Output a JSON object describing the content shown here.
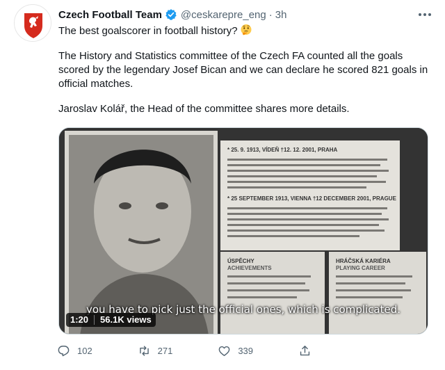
{
  "author": {
    "name": "Czech Football Team",
    "handle": "@ceskarepre_eng",
    "separator": "·",
    "time": "3h",
    "avatar_icon": "czech-fa-lion-crest",
    "verified_icon": "verified-badge-icon",
    "brand_color": "#d52b1e"
  },
  "tweet": {
    "line1": "The best goalscorer in football history?",
    "line1_emoji": "thinking-face-emoji",
    "paragraph2": "The History and Statistics committee of the Czech FA counted all the goals scored by the legendary Josef Bican and we can declare he scored 821 goals in official matches.",
    "paragraph3": "Jaroslav Kolář, the Head of the committee shares more details."
  },
  "media": {
    "caption": "you have to pick just the official ones, which is complicated.",
    "duration": "1:20",
    "views": "56.1K views",
    "exhibit": {
      "line1": "* 25. 9. 1913, VÍDEŇ  †12. 12. 2001, PRAHA",
      "line2": "* 25 SEPTEMBER 1913, VIENNA  †12 DECEMBER 2001, PRAGUE",
      "achievements_cz": "ÚSPĚCHY",
      "achievements_en": "ACHIEVEMENTS",
      "career_cz": "HRÁČSKÁ KARIÉRA",
      "career_en": "PLAYING CAREER"
    }
  },
  "actions": {
    "replies": "102",
    "retweets": "271",
    "likes": "339",
    "reply_icon": "reply-icon",
    "retweet_icon": "retweet-icon",
    "like_icon": "heart-icon",
    "share_icon": "share-icon"
  },
  "colors": {
    "text": "#0f1419",
    "secondary": "#536471",
    "verified": "#1d9bf0"
  }
}
